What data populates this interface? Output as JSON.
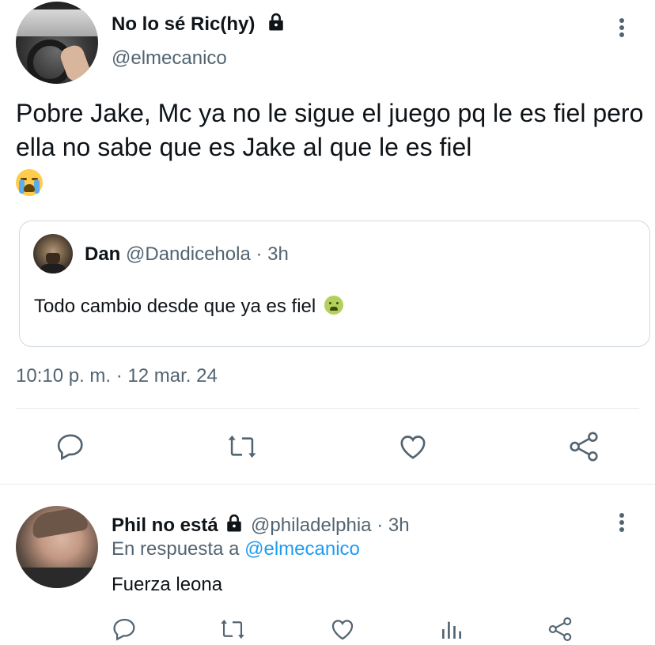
{
  "main_tweet": {
    "display_name": "No lo sé Ric(hy)",
    "handle": "@elmecanico",
    "text": "Pobre Jake, Mc ya no le sigue el juego pq le es fiel pero ella no sabe que es Jake al que le es fiel",
    "emoji": "loudly-crying-face",
    "timestamp": "10:10 p. m. · 12 mar. 24"
  },
  "quote": {
    "display_name": "Dan",
    "handle": "@Dandicehola",
    "time": "· 3h",
    "text": "Todo cambio desde que ya es fiel",
    "emoji": "nauseated-face"
  },
  "main_actions": [
    "reply-icon",
    "retweet-icon",
    "like-icon",
    "share-icon"
  ],
  "reply": {
    "display_name": "Phil no está",
    "handle": "@philadelphia",
    "time": "· 3h",
    "replying_prefix": "En respuesta a",
    "replying_handle": "@elmecanico",
    "text": "Fuerza leona"
  },
  "reply_actions": [
    "reply-icon",
    "retweet-icon",
    "like-icon",
    "views-icon",
    "share-icon"
  ],
  "colors": {
    "text": "#0f1419",
    "secondary": "#536471",
    "link": "#1d9bf0",
    "border": "#cfd9de"
  }
}
